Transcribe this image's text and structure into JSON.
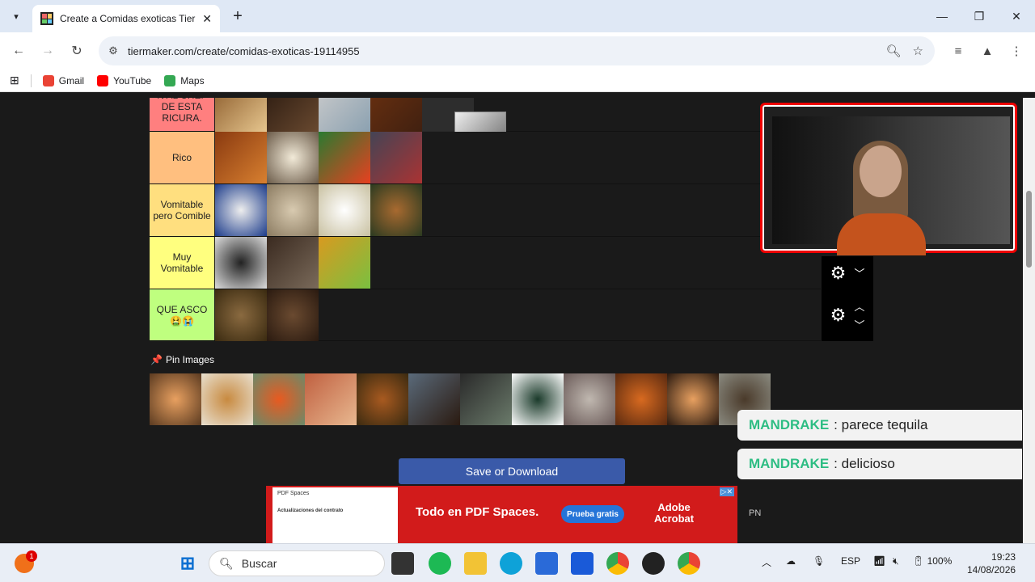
{
  "browser": {
    "tab_title": "Create a Comidas exoticas Tier List",
    "url": "tiermaker.com/create/comidas-exoticas-19114955",
    "bookmarks": [
      {
        "label": "Gmail",
        "color": "#ea4335"
      },
      {
        "label": "YouTube",
        "color": "#ff0000"
      },
      {
        "label": "Maps",
        "color": "#34a853"
      }
    ]
  },
  "tiers": [
    {
      "label": "N AL CHEF DE ESTA RICURA.",
      "color": "#ff7f7f",
      "image_count": 5
    },
    {
      "label": "Rico",
      "color": "#ffbf7f",
      "image_count": 4
    },
    {
      "label": "Vomitable pero Comible",
      "color": "#ffdf7f",
      "image_count": 4
    },
    {
      "label": "Muy Vomitable",
      "color": "#ffff7f",
      "image_count": 3
    },
    {
      "label": "QUE ASCO 🤮😭",
      "color": "#bfff7f",
      "image_count": 2
    }
  ],
  "pin_images_label": "Pin Images",
  "save_button": "Save or Download",
  "ad": {
    "doc_header": "PDF Spaces",
    "doc_title": "Actualizaciones del contrato",
    "headline": "Todo en PDF Spaces.",
    "cta": "Prueba gratis",
    "brand_line1": "Adobe",
    "brand_line2": "Acrobat"
  },
  "pn_label": "PN",
  "chat": [
    {
      "user": "MANDRAKE",
      "message": ": parece tequila"
    },
    {
      "user": "MANDRAKE",
      "message": ": delicioso"
    }
  ],
  "taskbar": {
    "search_placeholder": "Buscar",
    "notification_badge": "1",
    "language": "ESP",
    "battery": "100%",
    "time": "19:23",
    "date": "14/08/2026"
  },
  "colors": {
    "accent": "#3a5aa9",
    "chat_user": "#2dbd83",
    "ad_bg": "#d21b1b",
    "cam_border": "#e00000"
  }
}
